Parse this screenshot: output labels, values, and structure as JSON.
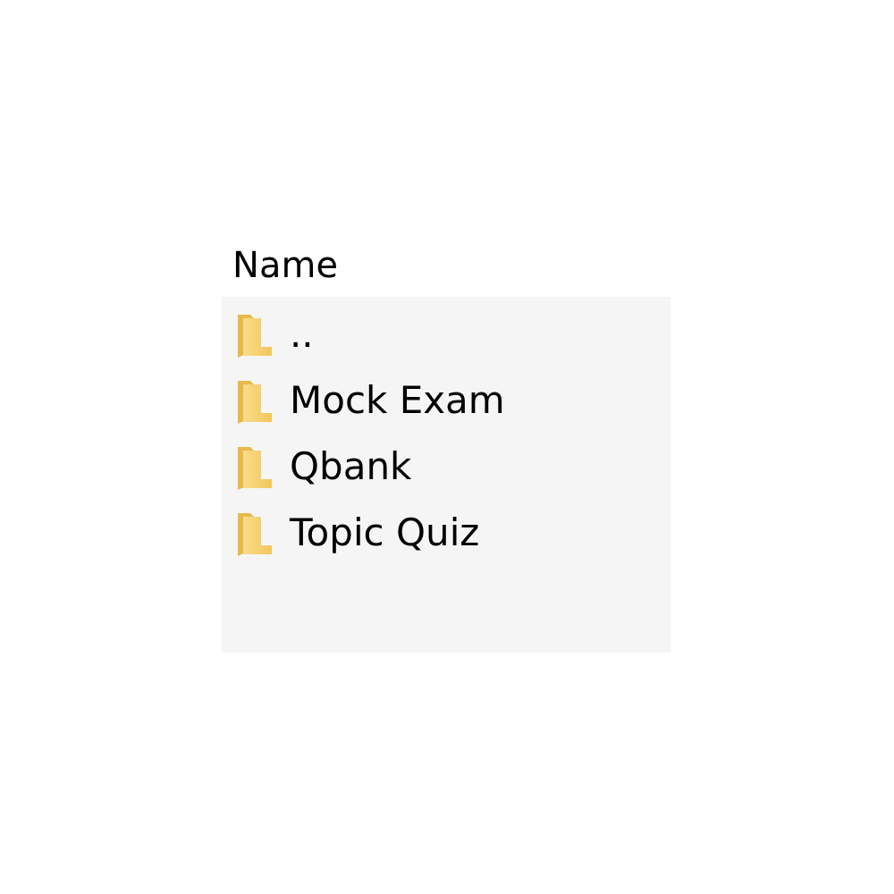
{
  "header": {
    "label": "Name"
  },
  "items": [
    {
      "name": ".."
    },
    {
      "name": "Mock Exam"
    },
    {
      "name": "Qbank"
    },
    {
      "name": "Topic Quiz"
    }
  ]
}
